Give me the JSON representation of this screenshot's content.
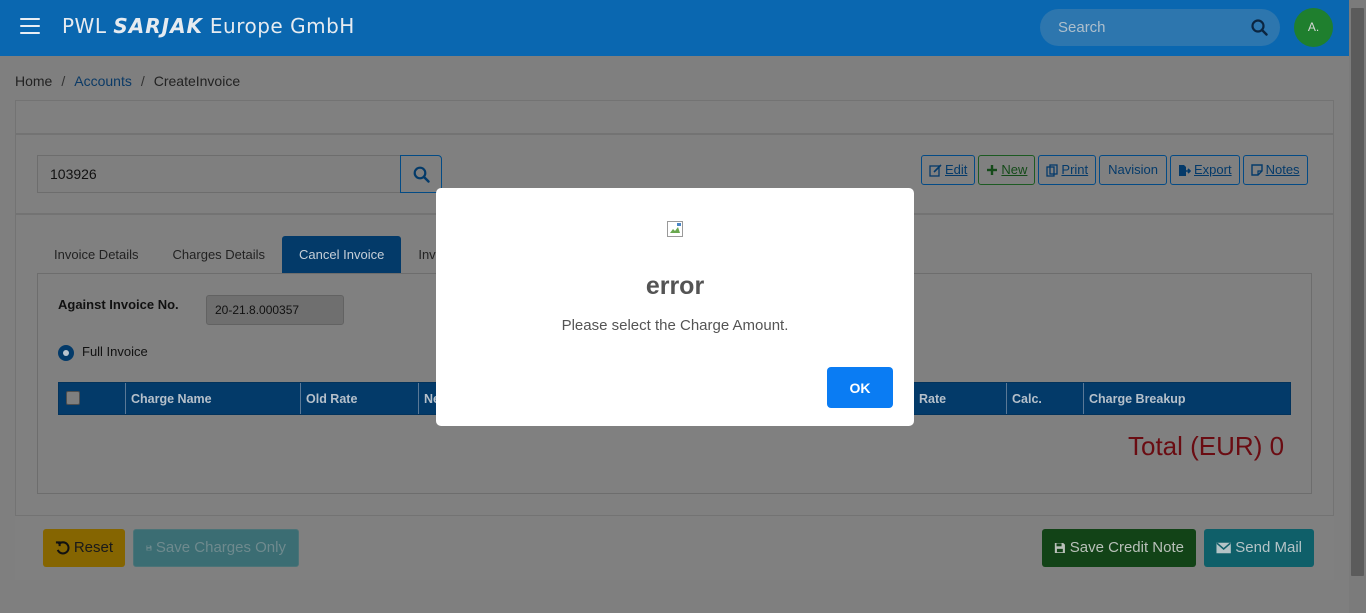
{
  "header": {
    "brand_prefix": "PWL",
    "brand_logo": "SARJAK",
    "brand_suffix": "Europe GmbH",
    "search_placeholder": "Search",
    "avatar": "A."
  },
  "breadcrumb": [
    "Home",
    "Accounts",
    "CreateInvoice"
  ],
  "invoice_search": {
    "value": "103926"
  },
  "toolbar": {
    "edit": "Edit",
    "new": "New",
    "print": "Print",
    "navision": "Navision",
    "export": "Export",
    "notes": "Notes"
  },
  "tabs": [
    "Invoice Details",
    "Charges Details",
    "Cancel Invoice",
    "Invo"
  ],
  "cancel_invoice": {
    "against_label": "Against Invoice No.",
    "against_value": "20-21.8.000357",
    "radio_label": "Full Invoice",
    "grid_columns": [
      "Charge Name",
      "Old Rate",
      "Ne",
      "Rate",
      "Calc.",
      "Charge Breakup"
    ],
    "total": "Total (EUR) 0"
  },
  "footer": {
    "reset": "Reset",
    "save_charges": "Save Charges Only",
    "save_credit": "Save Credit Note",
    "send_mail": "Send Mail"
  },
  "modal": {
    "title": "error",
    "message": "Please select the Charge Amount.",
    "ok": "OK"
  },
  "colors": {
    "topbar": "#0a67b0",
    "accent": "#0a7cf3",
    "total": "#c0272d"
  }
}
